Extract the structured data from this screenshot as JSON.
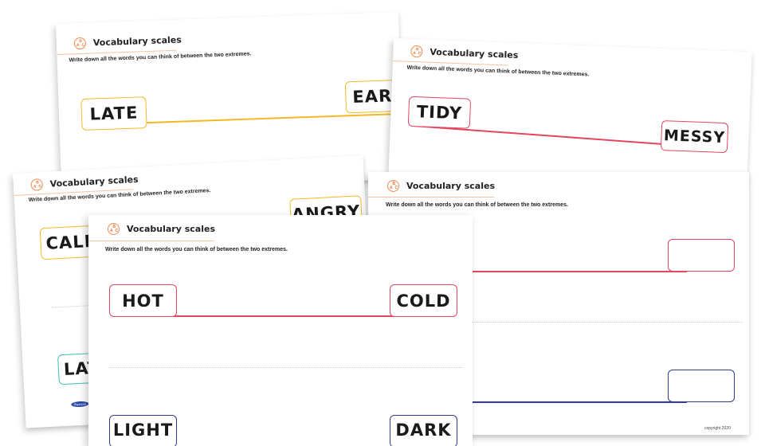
{
  "common": {
    "title": "Vocabulary scales",
    "instruction": "Write down all the words you can think of between the two extremes.",
    "abc_icon": [
      "A",
      "B",
      "C"
    ]
  },
  "colors": {
    "orange": "#f08a4b",
    "yellow": "#f4b826",
    "red": "#e4455f",
    "navy": "#2f3a8a",
    "teal": "#3fbfb5"
  },
  "sheets": {
    "late_early": {
      "left": "LATE",
      "right": "EARLY",
      "line_color": "#f4b826"
    },
    "tidy_messy": {
      "left": "TIDY",
      "right": "MESSY",
      "line_color": "#e4455f"
    },
    "calm_angry": {
      "left": "CALM",
      "right": "ANGRY",
      "second_left": "LATE",
      "line_color": "#f4b826",
      "second_color": "#3fbfb5"
    },
    "blank": {
      "top_color": "#e4455f",
      "bottom_color": "#2f3a8a",
      "copyright": "copyright 2020"
    },
    "hot_cold": {
      "left": "HOT",
      "right": "COLD",
      "second_left": "LIGHT",
      "second_right": "DARK",
      "line_color": "#e4455f",
      "second_color": "#2f3a8a"
    }
  },
  "logo_text": "Plazoom"
}
